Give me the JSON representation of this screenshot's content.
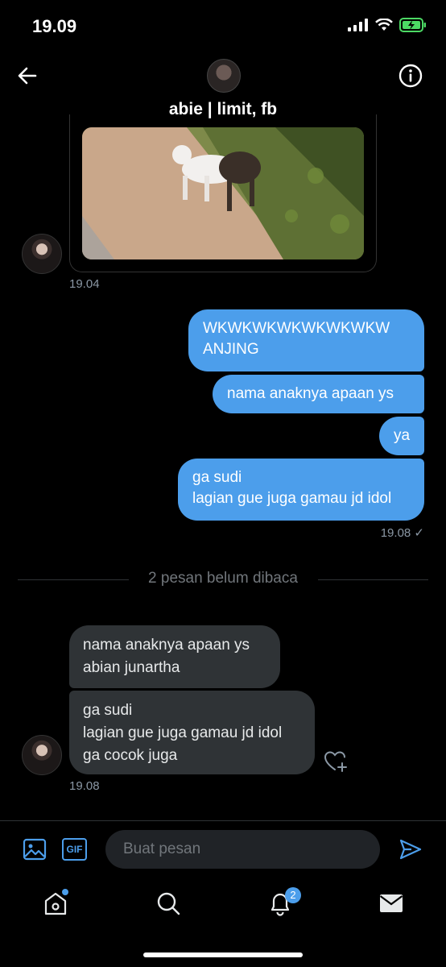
{
  "status_bar": {
    "time": "19.09"
  },
  "header": {
    "title": "abie | limit, fb"
  },
  "thread": {
    "shared_image_time": "19.04",
    "sent_messages": [
      {
        "line1": "WKWKWKWKWKWKWKW",
        "line2": "ANJING"
      },
      {
        "line1": "nama anaknya apaan ys"
      },
      {
        "line1": "ya"
      },
      {
        "line1": "ga sudi",
        "line2": "lagian gue juga gamau jd idol"
      }
    ],
    "sent_time": "19.08 ✓",
    "unread_divider": "2 pesan belum dibaca",
    "received_messages": [
      {
        "line1": "nama anaknya apaan ys",
        "line2": "abian junartha"
      },
      {
        "line1": "ga sudi",
        "line2": "lagian gue juga gamau jd idol",
        "line3": "ga cocok juga"
      }
    ],
    "received_time": "19.08"
  },
  "composer": {
    "placeholder": "Buat pesan",
    "gif_label": "GIF"
  },
  "tab_bar": {
    "notifications_badge": "2"
  },
  "colors": {
    "accent": "#4c9eeb",
    "background": "#000000",
    "incoming_bubble": "#2f3336"
  }
}
